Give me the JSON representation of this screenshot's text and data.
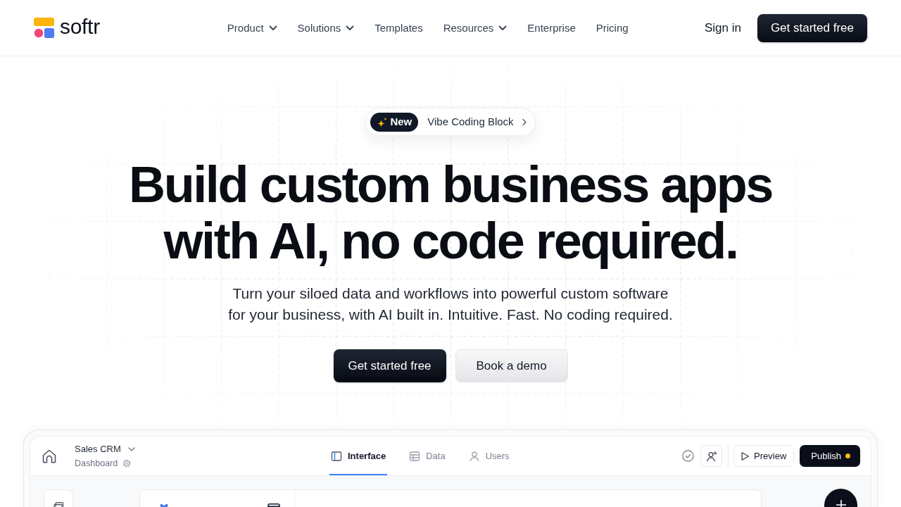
{
  "header": {
    "logo_text": "softr",
    "nav": [
      {
        "label": "Product",
        "has_menu": true
      },
      {
        "label": "Solutions",
        "has_menu": true
      },
      {
        "label": "Templates",
        "has_menu": false
      },
      {
        "label": "Resources",
        "has_menu": true
      },
      {
        "label": "Enterprise",
        "has_menu": false
      },
      {
        "label": "Pricing",
        "has_menu": false
      }
    ],
    "sign_in": "Sign in",
    "cta": "Get started free"
  },
  "hero": {
    "announcement": {
      "tag": "New",
      "text": "Vibe Coding Block"
    },
    "headline": "Build custom business apps with AI, no code required.",
    "subtitle": "Turn your siloed data and workflows into powerful custom software for your business, with AI built in. Intuitive. Fast. No coding required.",
    "buttons": [
      {
        "label": "Get started free",
        "kind": "primary"
      },
      {
        "label": "Book a demo",
        "kind": "secondary"
      }
    ]
  },
  "app_preview": {
    "app_name": "Sales CRM",
    "page_name": "Dashboard",
    "tabs": [
      {
        "label": "Interface",
        "selected": true
      },
      {
        "label": "Data",
        "selected": false
      },
      {
        "label": "Users",
        "selected": false
      }
    ],
    "preview_button": "Preview",
    "publish_button": {
      "label": "Publish",
      "unpublished_changes": true
    }
  }
}
